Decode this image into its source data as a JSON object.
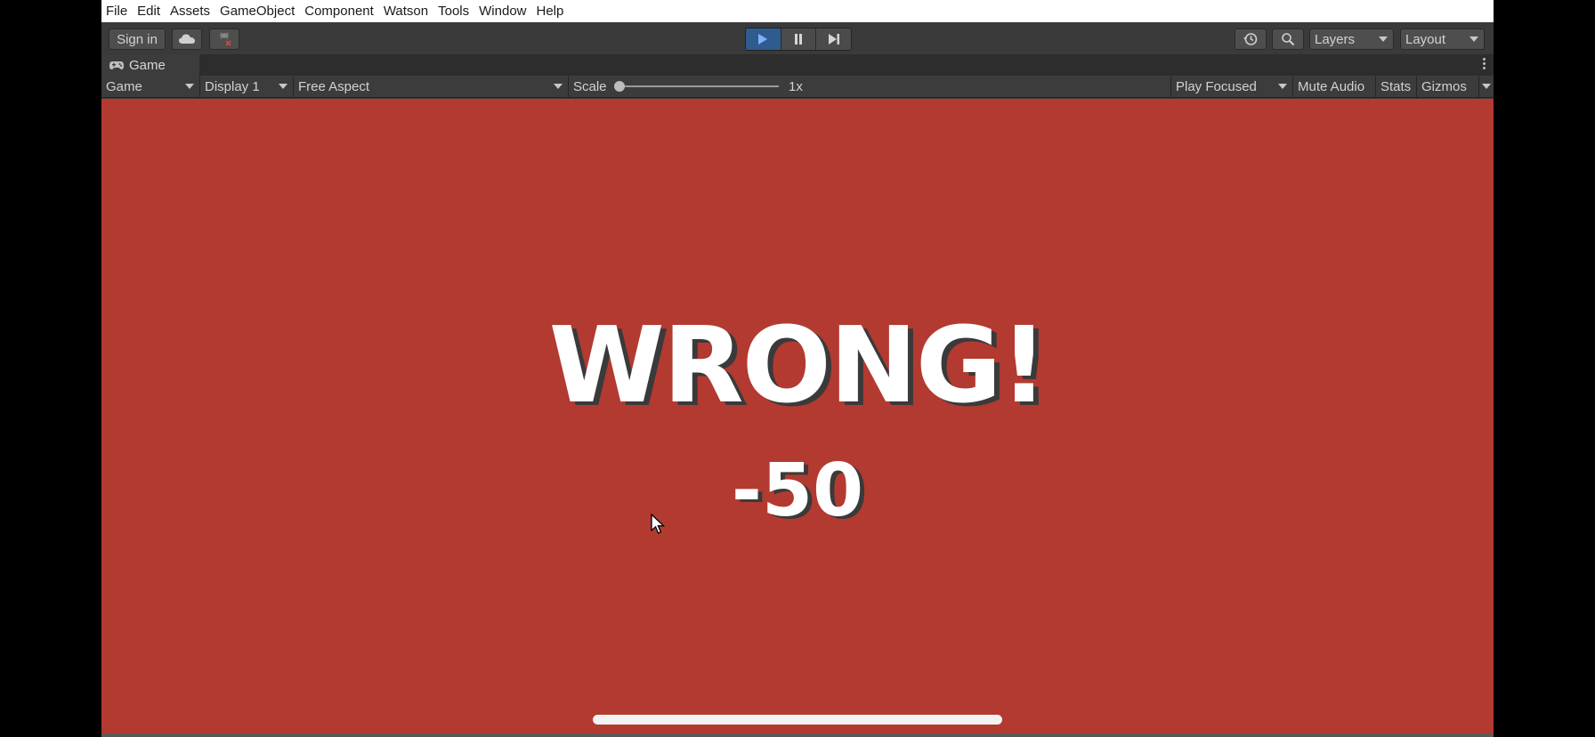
{
  "menu": {
    "items": [
      "File",
      "Edit",
      "Assets",
      "GameObject",
      "Component",
      "Watson",
      "Tools",
      "Window",
      "Help"
    ]
  },
  "toolbar": {
    "signin_label": "Sign in",
    "layers_label": "Layers",
    "layout_label": "Layout"
  },
  "tab": {
    "label": "Game"
  },
  "game_toolbar": {
    "view_mode": "Game",
    "display": "Display 1",
    "aspect": "Free Aspect",
    "scale_label": "Scale",
    "scale_value": "1x",
    "play_mode": "Play Focused",
    "mute_label": "Mute Audio",
    "stats_label": "Stats",
    "gizmos_label": "Gizmos"
  },
  "game": {
    "headline": "WRONG!",
    "score": "-50",
    "background_color": "#b33a30"
  },
  "icons": {
    "cloud": "cloud-icon",
    "collab": "collab-icon",
    "play": "play-icon",
    "pause": "pause-icon",
    "step": "step-icon",
    "history": "history-icon",
    "search": "search-icon",
    "gamepad": "gamepad-icon",
    "kebab": "kebab-menu-icon"
  },
  "colors": {
    "accent_play": "#2f5b8f",
    "game_bg": "#b33a30"
  }
}
